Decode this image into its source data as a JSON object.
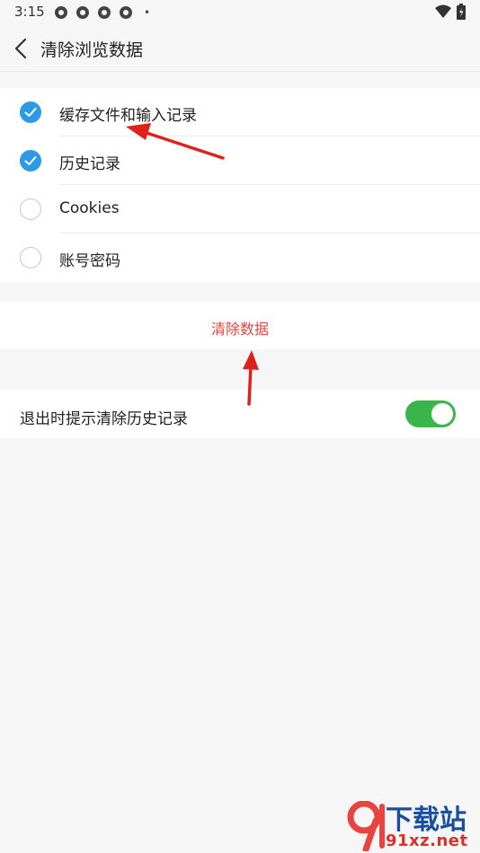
{
  "status_bar": {
    "time": "3:15",
    "dot": "•",
    "icons": [
      "notification-icon",
      "notification-icon",
      "notification-icon",
      "notification-icon",
      "wifi-icon",
      "battery-icon"
    ]
  },
  "header": {
    "back_icon": "chevron-left-icon",
    "title": "清除浏览数据"
  },
  "options": [
    {
      "label": "缓存文件和输入记录",
      "checked": true
    },
    {
      "label": "历史记录",
      "checked": true
    },
    {
      "label": "Cookies",
      "checked": false
    },
    {
      "label": "账号密码",
      "checked": false
    }
  ],
  "clear_button": {
    "label": "清除数据",
    "color": "#e8443f"
  },
  "exit_setting": {
    "label": "退出时提示清除历史记录",
    "enabled": true
  },
  "colors": {
    "accent": "#2d9ae6",
    "toggle_on": "#39b549",
    "annotation_arrow": "#e0201a"
  },
  "watermark": {
    "brand": "下载站",
    "url": "91xz.net",
    "logo": "91"
  }
}
